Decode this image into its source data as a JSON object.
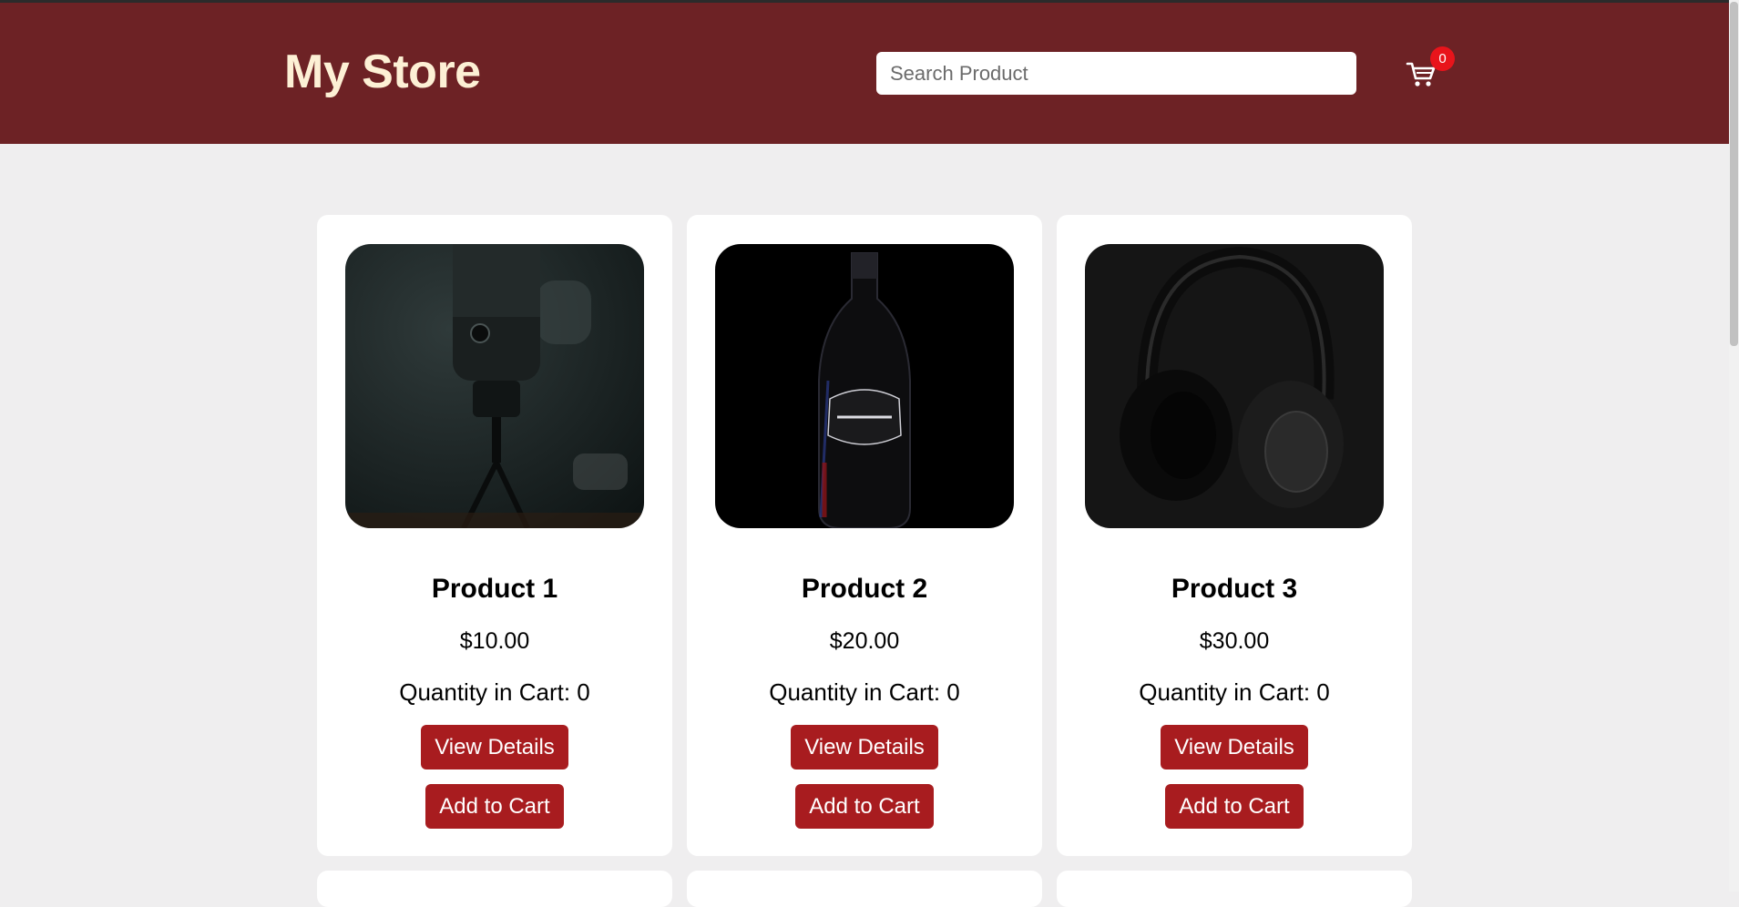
{
  "header": {
    "brand": "My Store",
    "search_placeholder": "Search Product",
    "cart_count": "0"
  },
  "products": [
    {
      "name": "Product 1",
      "price": "$10.00",
      "quantity_label": "Quantity in Cart: 0",
      "view_label": "View Details",
      "add_label": "Add to Cart",
      "image": "microphone"
    },
    {
      "name": "Product 2",
      "price": "$20.00",
      "quantity_label": "Quantity in Cart: 0",
      "view_label": "View Details",
      "add_label": "Add to Cart",
      "image": "rum-bottle"
    },
    {
      "name": "Product 3",
      "price": "$30.00",
      "quantity_label": "Quantity in Cart: 0",
      "view_label": "View Details",
      "add_label": "Add to Cart",
      "image": "headphones"
    }
  ],
  "colors": {
    "header_bg": "#6d2225",
    "brand_text": "#fdf0d5",
    "button_bg": "#a81c1f",
    "badge_bg": "#e8141b",
    "page_bg": "#efeeef"
  }
}
